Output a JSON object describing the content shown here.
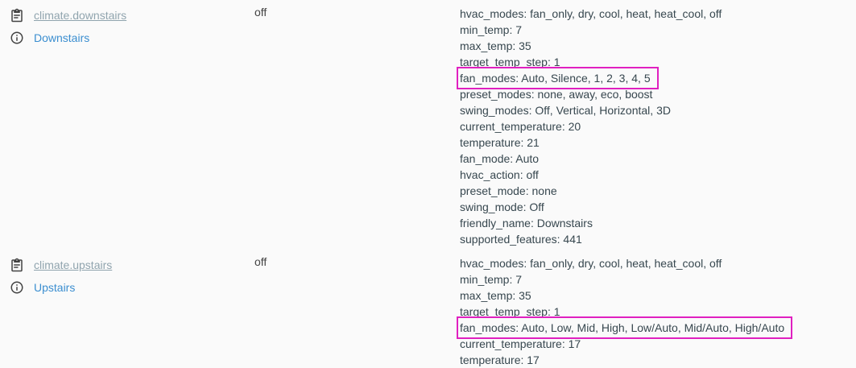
{
  "entities": [
    {
      "entity_id": "climate.downstairs",
      "friendly_name": "Downstairs",
      "state": "off",
      "attributes": [
        "hvac_modes: fan_only, dry, cool, heat, heat_cool, off",
        "min_temp: 7",
        "max_temp: 35",
        "target_temp_step: 1",
        "fan_modes: Auto, Silence, 1, 2, 3, 4, 5",
        "preset_modes: none, away, eco, boost",
        "swing_modes: Off, Vertical, Horizontal, 3D",
        "current_temperature: 20",
        "temperature: 21",
        "fan_mode: Auto",
        "hvac_action: off",
        "preset_mode: none",
        "swing_mode: Off",
        "friendly_name: Downstairs",
        "supported_features: 441"
      ],
      "highlighted_attribute_index": 4
    },
    {
      "entity_id": "climate.upstairs",
      "friendly_name": "Upstairs",
      "state": "off",
      "attributes": [
        "hvac_modes: fan_only, dry, cool, heat, heat_cool, off",
        "min_temp: 7",
        "max_temp: 35",
        "target_temp_step: 1",
        "fan_modes: Auto, Low, Mid, High, Low/Auto, Mid/Auto, High/Auto",
        "current_temperature: 17",
        "temperature: 17"
      ],
      "highlighted_attribute_index": 4
    }
  ],
  "icons": {
    "copy": "clipboard-copy-icon",
    "info": "info-circle-icon"
  },
  "colors": {
    "highlight_box": "#e020c0",
    "entity_link": "#90a4ae",
    "friendly_link": "#3b8ed0"
  }
}
